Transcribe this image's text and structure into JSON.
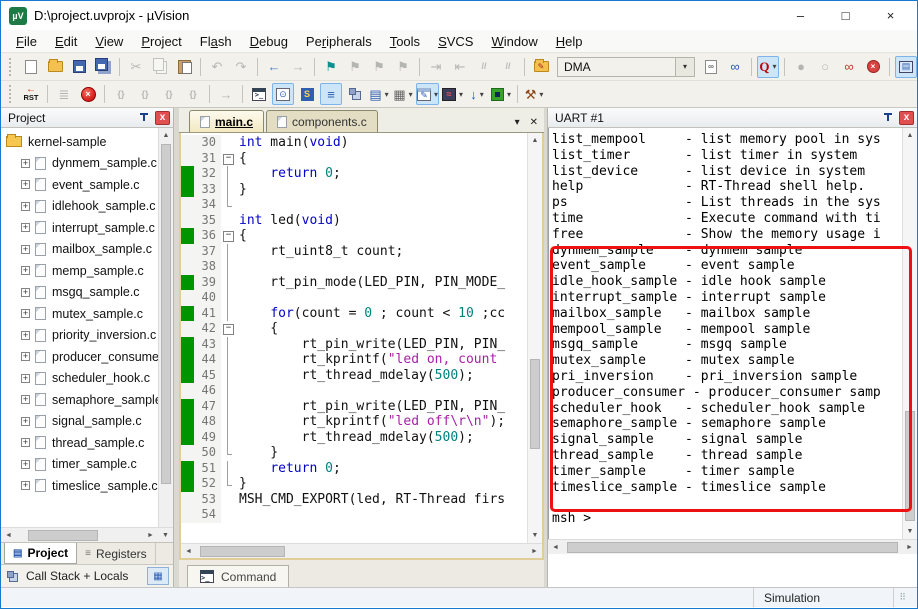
{
  "window": {
    "title": "D:\\project.uvprojx - µVision",
    "logo": "µV"
  },
  "titlebar": {
    "minimize": "–",
    "maximize": "□",
    "close": "×"
  },
  "menu": {
    "items": [
      {
        "label": "File",
        "accel": "F"
      },
      {
        "label": "Edit",
        "accel": "E"
      },
      {
        "label": "View",
        "accel": "V"
      },
      {
        "label": "Project",
        "accel": "P"
      },
      {
        "label": "Flash",
        "accel": "a"
      },
      {
        "label": "Debug",
        "accel": "D"
      },
      {
        "label": "Peripherals",
        "accel": "r"
      },
      {
        "label": "Tools",
        "accel": "T"
      },
      {
        "label": "SVCS",
        "accel": "S"
      },
      {
        "label": "Window",
        "accel": "W"
      },
      {
        "label": "Help",
        "accel": "H"
      }
    ]
  },
  "toolbar": {
    "target": "DMA",
    "row1": [
      {
        "n": "new-file-icon",
        "t": "page"
      },
      {
        "n": "open-file-icon",
        "t": "folder"
      },
      {
        "n": "save-icon",
        "t": "floppy"
      },
      {
        "n": "save-all-icon",
        "t": "floppy2"
      },
      {
        "sep": 1
      },
      {
        "n": "cut-icon",
        "g": "✂",
        "c": "#555",
        "dis": 1
      },
      {
        "n": "copy-icon",
        "t": "copy",
        "dis": 1
      },
      {
        "n": "paste-icon",
        "t": "paste"
      },
      {
        "sep": 1
      },
      {
        "n": "undo-icon",
        "g": "↶",
        "dis": 1
      },
      {
        "n": "redo-icon",
        "g": "↷",
        "dis": 1
      },
      {
        "sep": 1
      },
      {
        "n": "navigate-back-icon",
        "g": "←",
        "c": "#4a7fc9"
      },
      {
        "n": "navigate-forward-icon",
        "g": "→",
        "dis": 1
      },
      {
        "sep": 1
      },
      {
        "n": "bookmark-toggle-icon",
        "g": "⚑",
        "c": "#0d8f8f"
      },
      {
        "n": "bookmark-prev-icon",
        "g": "⚑",
        "dis": 1
      },
      {
        "n": "bookmark-next-icon",
        "g": "⚑",
        "dis": 1
      },
      {
        "n": "bookmark-clear-icon",
        "g": "⚑",
        "dis": 1
      },
      {
        "sep": 1
      },
      {
        "n": "indent-icon",
        "g": "⇥",
        "dis": 1
      },
      {
        "n": "unindent-icon",
        "g": "⇤",
        "dis": 1
      },
      {
        "n": "comment-icon",
        "g": "//",
        "dis": 1,
        "small": 1
      },
      {
        "n": "uncomment-icon",
        "g": "//",
        "dis": 1,
        "small": 1
      },
      {
        "sep": 1
      },
      {
        "n": "target-options-icon",
        "t": "folder",
        "g": "✎"
      },
      {
        "combo": 1
      },
      {
        "n": "find-in-files-icon",
        "t": "page",
        "g": "∞"
      },
      {
        "n": "incremental-find-icon",
        "g": "∞",
        "c": "#2a5db0"
      },
      {
        "sep": 1
      },
      {
        "n": "find-icon",
        "t": "findq",
        "g": "Q",
        "active": 1,
        "drop": 1
      },
      {
        "sep": 1
      },
      {
        "n": "breakpoint-insert-icon",
        "g": "●",
        "dis": 1
      },
      {
        "n": "breakpoint-enable-icon",
        "g": "○",
        "dis": 1
      },
      {
        "n": "breakpoint-disable-all-icon",
        "g": "∞",
        "c": "#c0392b"
      },
      {
        "n": "breakpoint-kill-all-icon",
        "t": "killbp",
        "g": "×"
      },
      {
        "sep": 1
      },
      {
        "n": "project-window-icon",
        "t": "projwin",
        "g": "▤",
        "active": 1
      }
    ],
    "row2": [
      {
        "n": "reset-cpu-icon",
        "t": "rst",
        "g": "RST"
      },
      {
        "sep": 1
      },
      {
        "n": "show-next-statement-icon",
        "g": "≣",
        "dis": 1
      },
      {
        "n": "stop-debug-icon",
        "t": "stop",
        "g": "×"
      },
      {
        "sep": 1
      },
      {
        "n": "step-into-icon",
        "g": "{}",
        "dis": 1,
        "small": 1
      },
      {
        "n": "step-over-icon",
        "g": "{}",
        "dis": 1,
        "small": 1
      },
      {
        "n": "step-out-icon",
        "g": "{}",
        "dis": 1,
        "small": 1
      },
      {
        "n": "run-to-cursor-icon",
        "g": "{}",
        "dis": 1,
        "small": 1
      },
      {
        "sep": 1
      },
      {
        "n": "goto-next-icon",
        "g": "→",
        "dis": 1
      },
      {
        "sep": 1
      },
      {
        "n": "command-window-icon",
        "t": "cmdwin",
        "g": ">_"
      },
      {
        "n": "disassembly-window-icon",
        "t": "disasm",
        "g": "⊙",
        "active": 1
      },
      {
        "n": "symbol-window-icon",
        "t": "symwin",
        "g": "S"
      },
      {
        "n": "registers-window-icon",
        "g": "≡",
        "c": "#2a5db0",
        "active": 1
      },
      {
        "n": "call-stack-window-icon",
        "t": "stack2"
      },
      {
        "n": "watch-window-icon",
        "g": "▤",
        "c": "#2a5db0",
        "drop": 1
      },
      {
        "n": "memory-window-icon",
        "g": "▦",
        "c": "#666",
        "drop": 1
      },
      {
        "n": "serial-window-icon",
        "t": "winpen",
        "g": "✎",
        "active": 1,
        "drop": 1
      },
      {
        "n": "analysis-window-icon",
        "t": "analysis",
        "g": "≈",
        "drop": 1
      },
      {
        "n": "system-viewer-icon",
        "g": "↓",
        "c": "#2a5db0",
        "drop": 1
      },
      {
        "n": "peripherals-icon",
        "t": "chip",
        "drop": 1
      },
      {
        "sep": 1
      },
      {
        "n": "toolbox-icon",
        "g": "⚒",
        "c": "#8a4513",
        "drop": 1
      }
    ]
  },
  "project_panel": {
    "title": "Project",
    "root": "kernel-sample",
    "files": [
      "dynmem_sample.c",
      "event_sample.c",
      "idlehook_sample.c",
      "interrupt_sample.c",
      "mailbox_sample.c",
      "memp_sample.c",
      "msgq_sample.c",
      "mutex_sample.c",
      "priority_inversion.c",
      "producer_consumer.c",
      "scheduler_hook.c",
      "semaphore_sample.c",
      "signal_sample.c",
      "thread_sample.c",
      "timer_sample.c",
      "timeslice_sample.c"
    ]
  },
  "editor": {
    "tabs": [
      {
        "label": "main.c",
        "active": true
      },
      {
        "label": "components.c",
        "active": false
      }
    ],
    "lines": [
      {
        "n": 30,
        "f": "",
        "g": 0,
        "s": [
          [
            "kw",
            "int"
          ],
          [
            "pl",
            " main("
          ],
          [
            "kw",
            "void"
          ],
          [
            "pl",
            ")"
          ]
        ]
      },
      {
        "n": 31,
        "f": "b",
        "g": 0,
        "s": [
          [
            "pl",
            "{"
          ]
        ]
      },
      {
        "n": 32,
        "f": "l",
        "g": 1,
        "s": [
          [
            "pl",
            "    "
          ],
          [
            "kw",
            "return"
          ],
          [
            "pl",
            " "
          ],
          [
            "num",
            "0"
          ],
          [
            "pl",
            ";"
          ]
        ]
      },
      {
        "n": 33,
        "f": "l",
        "g": 1,
        "s": [
          [
            "pl",
            "}"
          ]
        ]
      },
      {
        "n": 34,
        "f": "e",
        "g": 0,
        "s": []
      },
      {
        "n": 35,
        "f": "",
        "g": 0,
        "s": [
          [
            "kw",
            "int"
          ],
          [
            "pl",
            " led("
          ],
          [
            "kw",
            "void"
          ],
          [
            "pl",
            ")"
          ]
        ]
      },
      {
        "n": 36,
        "f": "b",
        "g": 1,
        "s": [
          [
            "pl",
            "{"
          ]
        ]
      },
      {
        "n": 37,
        "f": "l",
        "g": 0,
        "s": [
          [
            "pl",
            "    rt_uint8_t count;"
          ]
        ]
      },
      {
        "n": 38,
        "f": "l",
        "g": 0,
        "s": []
      },
      {
        "n": 39,
        "f": "l",
        "g": 1,
        "s": [
          [
            "pl",
            "    rt_pin_mode(LED_PIN, PIN_MODE_"
          ]
        ]
      },
      {
        "n": 40,
        "f": "l",
        "g": 0,
        "s": []
      },
      {
        "n": 41,
        "f": "l",
        "g": 1,
        "s": [
          [
            "pl",
            "    "
          ],
          [
            "kw",
            "for"
          ],
          [
            "pl",
            "(count = "
          ],
          [
            "num",
            "0"
          ],
          [
            "pl",
            " ; count < "
          ],
          [
            "num",
            "10"
          ],
          [
            "pl",
            " ;cc"
          ]
        ]
      },
      {
        "n": 42,
        "f": "b",
        "g": 0,
        "s": [
          [
            "pl",
            "    {"
          ]
        ]
      },
      {
        "n": 43,
        "f": "l",
        "g": 1,
        "s": [
          [
            "pl",
            "        rt_pin_write(LED_PIN, PIN_"
          ]
        ]
      },
      {
        "n": 44,
        "f": "l",
        "g": 1,
        "s": [
          [
            "pl",
            "        rt_kprintf("
          ],
          [
            "str",
            "\"led on, count"
          ]
        ]
      },
      {
        "n": 45,
        "f": "l",
        "g": 1,
        "s": [
          [
            "pl",
            "        rt_thread_mdelay("
          ],
          [
            "num",
            "500"
          ],
          [
            "pl",
            ");"
          ]
        ]
      },
      {
        "n": 46,
        "f": "l",
        "g": 0,
        "s": []
      },
      {
        "n": 47,
        "f": "l",
        "g": 1,
        "s": [
          [
            "pl",
            "        rt_pin_write(LED_PIN, PIN_"
          ]
        ]
      },
      {
        "n": 48,
        "f": "l",
        "g": 1,
        "s": [
          [
            "pl",
            "        rt_kprintf("
          ],
          [
            "str",
            "\"led off\\r\\n\""
          ],
          [
            "pl",
            ");"
          ]
        ]
      },
      {
        "n": 49,
        "f": "l",
        "g": 1,
        "s": [
          [
            "pl",
            "        rt_thread_mdelay("
          ],
          [
            "num",
            "500"
          ],
          [
            "pl",
            ");"
          ]
        ]
      },
      {
        "n": 50,
        "f": "e",
        "g": 0,
        "s": [
          [
            "pl",
            "    }"
          ]
        ]
      },
      {
        "n": 51,
        "f": "l",
        "g": 1,
        "s": [
          [
            "pl",
            "    "
          ],
          [
            "kw",
            "return"
          ],
          [
            "pl",
            " "
          ],
          [
            "num",
            "0"
          ],
          [
            "pl",
            ";"
          ]
        ]
      },
      {
        "n": 52,
        "f": "e",
        "g": 1,
        "s": [
          [
            "pl",
            "}"
          ]
        ]
      },
      {
        "n": 53,
        "f": "",
        "g": 0,
        "s": [
          [
            "pl",
            "MSH_CMD_EXPORT(led, RT-Thread firs"
          ]
        ]
      },
      {
        "n": 54,
        "f": "",
        "g": 0,
        "s": []
      }
    ]
  },
  "uart": {
    "title": "UART #1",
    "lines": [
      "list_mempool     - list memory pool in sys",
      "list_timer       - list timer in system",
      "list_device      - list device in system",
      "help             - RT-Thread shell help.",
      "ps               - List threads in the sys",
      "time             - Execute command with ti",
      "free             - Show the memory usage i",
      "dynmem_sample    - dynmem sample",
      "event_sample     - event sample",
      "idle_hook_sample - idle hook sample",
      "interrupt_sample - interrupt sample",
      "mailbox_sample   - mailbox sample",
      "mempool_sample   - mempool sample",
      "msgq_sample      - msgq sample",
      "mutex_sample     - mutex sample",
      "pri_inversion    - pri_inversion sample",
      "producer_consumer - producer_consumer samp",
      "scheduler_hook   - scheduler_hook sample",
      "semaphore_sample - semaphore sample",
      "signal_sample    - signal sample",
      "thread_sample    - thread sample",
      "timer_sample     - timer sample",
      "timeslice_sample - timeslice sample",
      "",
      "msh >"
    ]
  },
  "bottom": {
    "tabs": [
      {
        "label": "Project",
        "active": true
      },
      {
        "label": "Registers",
        "active": false
      }
    ],
    "callstack_label": "Call Stack + Locals",
    "command_tab": "Command"
  },
  "statusbar": {
    "mode": "Simulation"
  },
  "colors": {
    "window_border": "#1779d0",
    "green_margin": "#009400",
    "keyword": "#0303c7",
    "number": "#008080",
    "string": "#a820a8",
    "annotation_red": "#ee1111"
  }
}
